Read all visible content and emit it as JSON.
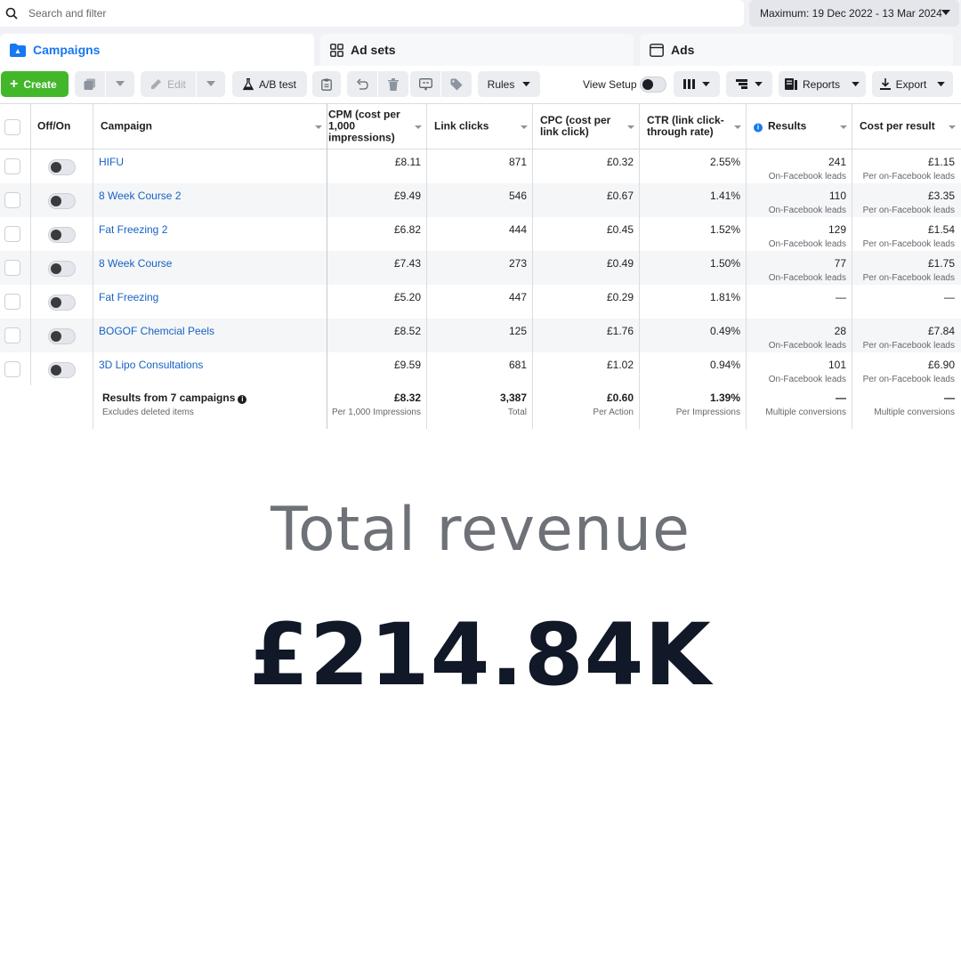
{
  "search": {
    "placeholder": "Search and filter"
  },
  "date_range": "Maximum: 19 Dec 2022 - 13 Mar 2024",
  "tabs": [
    {
      "label": "Campaigns",
      "icon": "folder-icon",
      "active": true
    },
    {
      "label": "Ad sets",
      "icon": "grid-icon",
      "active": false
    },
    {
      "label": "Ads",
      "icon": "ad-icon",
      "active": false
    }
  ],
  "toolbar": {
    "create": "Create",
    "edit": "Edit",
    "ab_test": "A/B test",
    "rules": "Rules",
    "view_setup": "View Setup",
    "reports": "Reports",
    "export": "Export"
  },
  "columns": {
    "off_on": "Off/On",
    "campaign": "Campaign",
    "cpm": "CPM (cost per 1,000 impressions)",
    "link_clicks": "Link clicks",
    "cpc": "CPC (cost per link click)",
    "ctr": "CTR (link click-through rate)",
    "results": "Results",
    "cost_per_result": "Cost per result"
  },
  "rows": [
    {
      "name": "HIFU",
      "cpm": "£8.11",
      "clicks": "871",
      "cpc": "£0.32",
      "ctr": "2.55%",
      "results": "241",
      "results_sub": "On-Facebook leads",
      "cpr": "£1.15",
      "cpr_sub": "Per on-Facebook leads"
    },
    {
      "name": "8 Week Course 2",
      "cpm": "£9.49",
      "clicks": "546",
      "cpc": "£0.67",
      "ctr": "1.41%",
      "results": "110",
      "results_sub": "On-Facebook leads",
      "cpr": "£3.35",
      "cpr_sub": "Per on-Facebook leads"
    },
    {
      "name": "Fat Freezing 2",
      "cpm": "£6.82",
      "clicks": "444",
      "cpc": "£0.45",
      "ctr": "1.52%",
      "results": "129",
      "results_sub": "On-Facebook leads",
      "cpr": "£1.54",
      "cpr_sub": "Per on-Facebook leads"
    },
    {
      "name": "8 Week Course",
      "cpm": "£7.43",
      "clicks": "273",
      "cpc": "£0.49",
      "ctr": "1.50%",
      "results": "77",
      "results_sub": "On-Facebook leads",
      "cpr": "£1.75",
      "cpr_sub": "Per on-Facebook leads"
    },
    {
      "name": "Fat Freezing",
      "cpm": "£5.20",
      "clicks": "447",
      "cpc": "£0.29",
      "ctr": "1.81%",
      "results": "—",
      "results_sub": "",
      "cpr": "—",
      "cpr_sub": ""
    },
    {
      "name": "BOGOF Chemcial Peels",
      "cpm": "£8.52",
      "clicks": "125",
      "cpc": "£1.76",
      "ctr": "0.49%",
      "results": "28",
      "results_sub": "On-Facebook leads",
      "cpr": "£7.84",
      "cpr_sub": "Per on-Facebook leads"
    },
    {
      "name": "3D Lipo Consultations",
      "cpm": "£9.59",
      "clicks": "681",
      "cpc": "£1.02",
      "ctr": "0.94%",
      "results": "101",
      "results_sub": "On-Facebook leads",
      "cpr": "£6.90",
      "cpr_sub": "Per on-Facebook leads"
    }
  ],
  "summary": {
    "title": "Results from 7 campaigns",
    "subtitle": "Excludes deleted items",
    "cpm": "£8.32",
    "cpm_sub": "Per 1,000 Impressions",
    "clicks": "3,387",
    "clicks_sub": "Total",
    "cpc": "£0.60",
    "cpc_sub": "Per Action",
    "ctr": "1.39%",
    "ctr_sub": "Per Impressions",
    "results": "—",
    "results_sub": "Multiple conversions",
    "cpr": "—",
    "cpr_sub": "Multiple conversions"
  },
  "revenue": {
    "label": "Total revenue",
    "value": "£214.84K"
  },
  "colors": {
    "accent": "#1877f2",
    "create": "#42b72a",
    "link": "#1662c4"
  }
}
